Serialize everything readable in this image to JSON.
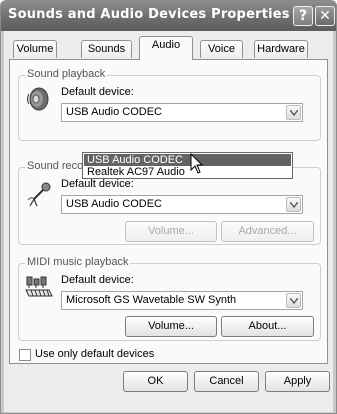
{
  "window": {
    "title": "Sounds and Audio Devices Properties",
    "help_glyph": "?",
    "close_glyph": "✕"
  },
  "tabs": [
    {
      "label": "Volume"
    },
    {
      "label": "Sounds"
    },
    {
      "label": "Audio"
    },
    {
      "label": "Voice"
    },
    {
      "label": "Hardware"
    }
  ],
  "active_tab": "Audio",
  "playback": {
    "group_title": "Sound playback",
    "icon": "speaker-icon",
    "default_label": "Default device:",
    "selected": "USB Audio CODEC",
    "dropdown_open": true,
    "options": [
      "USB Audio CODEC",
      "Realtek AC97 Audio"
    ],
    "highlighted_option": "USB Audio CODEC"
  },
  "recording": {
    "group_title": "Sound recording",
    "icon": "microphone-icon",
    "default_label": "Default device:",
    "selected": "USB Audio CODEC",
    "volume_button": "Volume...",
    "advanced_button": "Advanced..."
  },
  "midi": {
    "group_title": "MIDI music playback",
    "icon": "midi-keyboard-icon",
    "default_label": "Default device:",
    "selected": "Microsoft GS Wavetable SW Synth",
    "volume_button": "Volume...",
    "about_button": "About..."
  },
  "use_only_default": {
    "label": "Use only default devices",
    "checked": false
  },
  "footer": {
    "ok": "OK",
    "cancel": "Cancel",
    "apply": "Apply"
  },
  "colors": {
    "titlebar": "#6e6e6e",
    "dialog_bg": "#ececec",
    "selection": "#636363"
  }
}
